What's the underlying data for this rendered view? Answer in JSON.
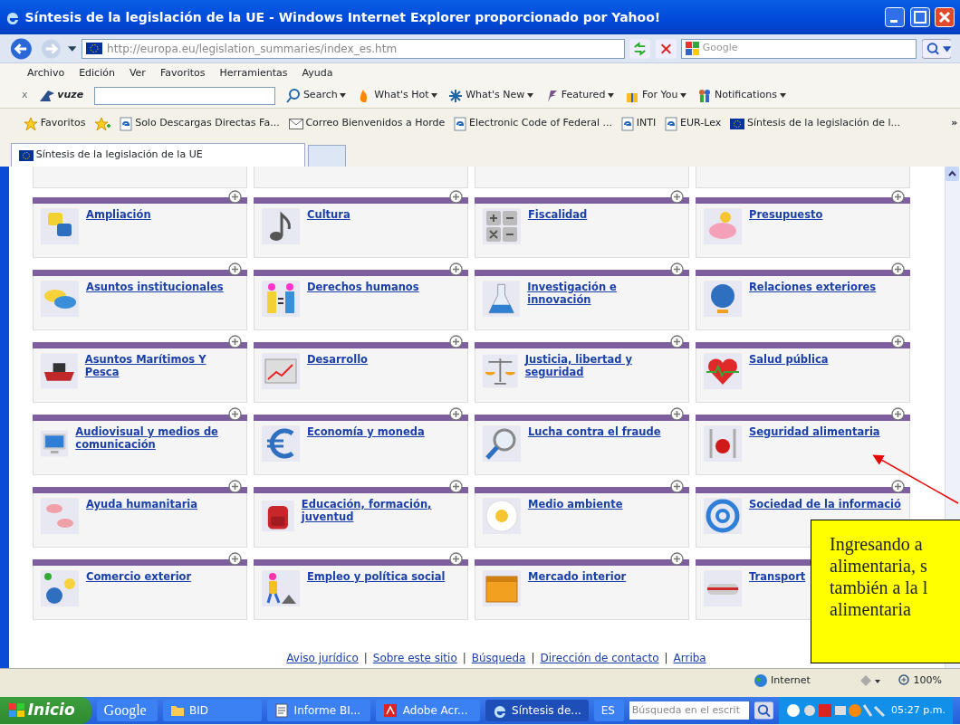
{
  "window": {
    "title": "Síntesis de la legislación de la UE - Windows Internet Explorer proporcionado por Yahoo!"
  },
  "address_bar": {
    "url": "http://europa.eu/legislation_summaries/index_es.htm"
  },
  "search_field": {
    "placeholder": "Google"
  },
  "menu": [
    "Archivo",
    "Edición",
    "Ver",
    "Favoritos",
    "Herramientas",
    "Ayuda"
  ],
  "toolbar": {
    "close": "x",
    "logo": "vuze",
    "items": [
      "Search",
      "What's Hot",
      "What's New",
      "Featured",
      "For You",
      "Notifications"
    ]
  },
  "favorites": {
    "label": "Favoritos",
    "links": [
      "Solo Descargas Directas Fa...",
      "Correo  Bienvenidos a Horde",
      "Electronic Code of Federal ...",
      "INTI",
      "EUR-Lex",
      "Síntesis de la legislación de l..."
    ],
    "more": "»"
  },
  "tabs": [
    {
      "label": "Síntesis de la legislación de la UE",
      "selected": true
    }
  ],
  "categories": [
    {
      "title": "Ampliación"
    },
    {
      "title": "Cultura"
    },
    {
      "title": "Fiscalidad"
    },
    {
      "title": "Presupuesto"
    },
    {
      "title": "Asuntos institucionales"
    },
    {
      "title": "Derechos humanos"
    },
    {
      "title": "Investigación e innovación"
    },
    {
      "title": "Relaciones exteriores"
    },
    {
      "title": "Asuntos Marítimos Y Pesca"
    },
    {
      "title": "Desarrollo"
    },
    {
      "title": "Justicia, libertad y seguridad"
    },
    {
      "title": "Salud pública"
    },
    {
      "title": "Audiovisual y medios de comunicación"
    },
    {
      "title": "Economía y moneda"
    },
    {
      "title": "Lucha contra el fraude"
    },
    {
      "title": "Seguridad alimentaria"
    },
    {
      "title": "Ayuda humanitaria"
    },
    {
      "title": "Educación, formación, juventud"
    },
    {
      "title": "Medio ambiente"
    },
    {
      "title": "Sociedad de la informació"
    },
    {
      "title": "Comercio exterior"
    },
    {
      "title": "Empleo y política social"
    },
    {
      "title": "Mercado interior"
    },
    {
      "title": "Transport"
    }
  ],
  "footer_links": [
    "Aviso jurídico",
    "Sobre este sitio",
    "Búsqueda",
    "Dirección de contacto",
    "Arriba"
  ],
  "footer_separator": "|",
  "status_bar": {
    "zone": "Internet",
    "zoom": "100%"
  },
  "annotation": {
    "lines": [
      "Ingresando a",
      "alimentaria, s",
      "también a la l",
      "alimentaria"
    ]
  },
  "taskbar": {
    "start": "Inicio",
    "google": "Google",
    "items": [
      {
        "label": "BID",
        "selected": false
      },
      {
        "label": "Informe BI...",
        "selected": false
      },
      {
        "label": "Adobe Acr...",
        "selected": false
      },
      {
        "label": "Síntesis de...",
        "selected": true
      }
    ],
    "language": "ES",
    "search_placeholder": "Búsqueda en el escrit",
    "clock": "05:27 p.m."
  }
}
